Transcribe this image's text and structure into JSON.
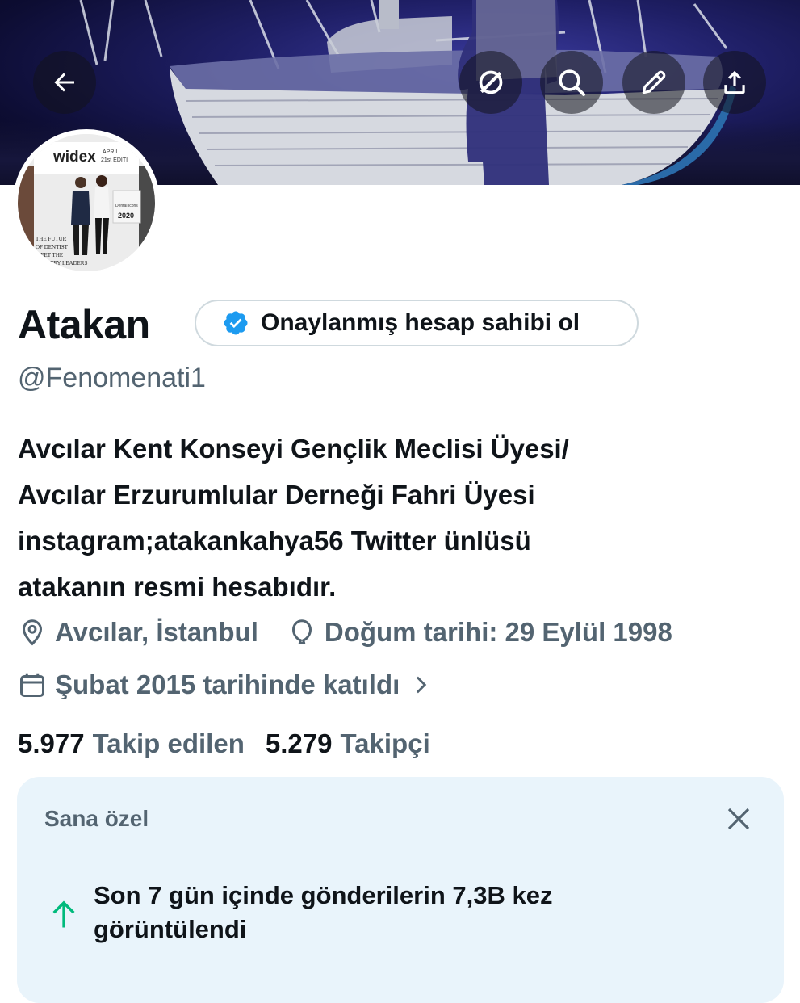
{
  "profile": {
    "name": "Atakan",
    "verify_cta": "Onaylanmış hesap sahibi ol",
    "handle": "@Fenomenati1",
    "bio_lines": [
      "Avcılar Kent Konseyi Gençlik Meclisi Üyesi/",
      "Avcılar Erzurumlular Derneği Fahri Üyesi",
      "instagram;atakankahya56 Twitter ünlüsü",
      "atakanın resmi hesabıdır."
    ],
    "location": "Avcılar, İstanbul",
    "birthday": "Doğum tarihi: 29 Eylül 1998",
    "joined": "Şubat 2015 tarihinde katıldı",
    "following_count": "5.977",
    "following_label": "Takip edilen",
    "followers_count": "5.279",
    "followers_label": "Takipçi"
  },
  "avatar_photo": {
    "sign_top": "widex",
    "sign_side_1": "APRIL",
    "sign_side_2": "21st EDITI",
    "poster_1": "Dental Icons",
    "poster_2": "2020",
    "wall_1": "THE FUTUR",
    "wall_2": "OF DENTIST",
    "wall_3": "MEET THE",
    "wall_4": "STRY LEADERS"
  },
  "toolbar": {
    "icons": [
      "back-arrow-icon",
      "grok-icon",
      "search-icon",
      "edit-pencil-icon",
      "share-icon"
    ]
  },
  "card": {
    "title": "Sana özel",
    "message": "Son 7 gün içinde gönderilerin 7,3B kez görüntülendi"
  },
  "colors": {
    "verified_blue": "#1d9bf0",
    "secondary_text": "#536471",
    "card_bg": "#e9f4fb",
    "trend_green": "#00ba7c"
  }
}
